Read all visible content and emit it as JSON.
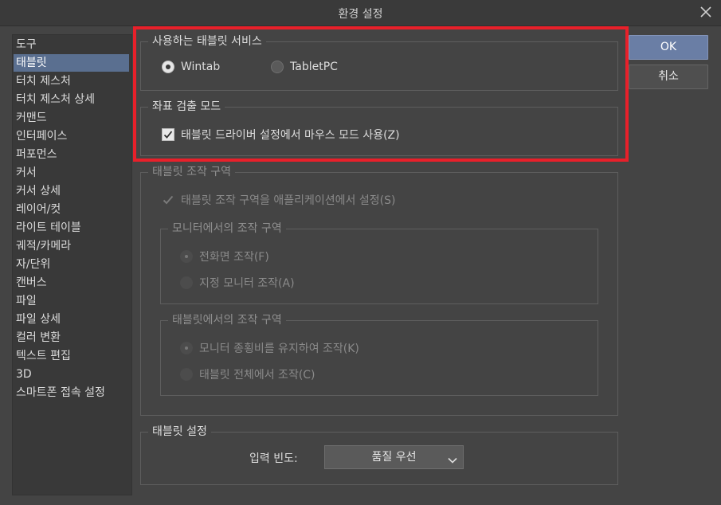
{
  "window": {
    "title": "환경 설정"
  },
  "sidebar": {
    "items": [
      {
        "label": "도구"
      },
      {
        "label": "태블릿"
      },
      {
        "label": "터치 제스처"
      },
      {
        "label": "터치 제스처 상세"
      },
      {
        "label": "커맨드"
      },
      {
        "label": "인터페이스"
      },
      {
        "label": "퍼포먼스"
      },
      {
        "label": "커서"
      },
      {
        "label": "커서 상세"
      },
      {
        "label": "레이어/컷"
      },
      {
        "label": "라이트 테이블"
      },
      {
        "label": "궤적/카메라"
      },
      {
        "label": "자/단위"
      },
      {
        "label": "캔버스"
      },
      {
        "label": "파일"
      },
      {
        "label": "파일 상세"
      },
      {
        "label": "컬러 변환"
      },
      {
        "label": "텍스트 편집"
      },
      {
        "label": "3D"
      },
      {
        "label": "스마트폰 접속 설정"
      }
    ],
    "selected": "태블릿"
  },
  "buttons": {
    "ok": "OK",
    "cancel": "취소"
  },
  "tablet_service": {
    "title": "사용하는 태블릿 서비스",
    "options": [
      {
        "label": "Wintab",
        "selected": true
      },
      {
        "label": "TabletPC",
        "selected": false
      }
    ]
  },
  "coordinate_mode": {
    "title": "좌표 검출 모드",
    "mouse_mode_label": "태블릿 드라이버 설정에서 마우스 모드 사용(Z)",
    "mouse_mode_checked": true
  },
  "operation_area": {
    "title": "태블릿 조작 구역",
    "app_setting_label": "태블릿 조작 구역을 애플리케이션에서 설정(S)",
    "monitor_area": {
      "title": "모니터에서의 조작 구역",
      "options": [
        {
          "label": "전화면 조작(F)",
          "selected": true
        },
        {
          "label": "지정 모니터 조작(A)",
          "selected": false
        }
      ]
    },
    "tablet_area": {
      "title": "태블릿에서의 조작 구역",
      "options": [
        {
          "label": "모니터 종횡비를 유지하여 조작(K)",
          "selected": true
        },
        {
          "label": "태블릿 전체에서 조작(C)",
          "selected": false
        }
      ]
    }
  },
  "tablet_settings": {
    "title": "태블릿 설정",
    "input_freq_label": "입력 빈도:",
    "input_freq_value": "품질 우선"
  },
  "colors": {
    "accent": "#6a7ea5",
    "selection": "#5a6f90",
    "highlight": "#e8202a"
  }
}
